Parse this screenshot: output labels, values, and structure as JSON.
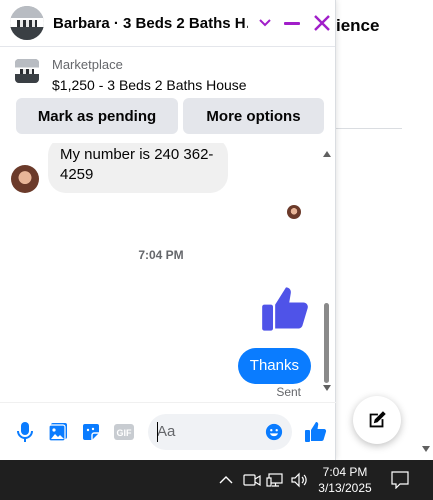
{
  "background": {
    "partial_text": "ience"
  },
  "chat": {
    "title": "Barbara · 3 Beds 2 Baths H…",
    "listing": {
      "label": "Marketplace",
      "title": "$1,250 - 3 Beds 2 Baths House"
    },
    "buttons": {
      "pending": "Mark as pending",
      "more": "More options"
    },
    "messages": {
      "incoming": "My number is 240 362-4259",
      "time_separator": "7:04 PM",
      "outgoing": "Thanks",
      "status": "Sent"
    },
    "composer": {
      "placeholder": "Aa"
    },
    "colors": {
      "accent": "#0a7cff",
      "header_controls": "#a11ec9"
    }
  },
  "taskbar": {
    "time": "7:04 PM",
    "date": "3/13/2025"
  }
}
